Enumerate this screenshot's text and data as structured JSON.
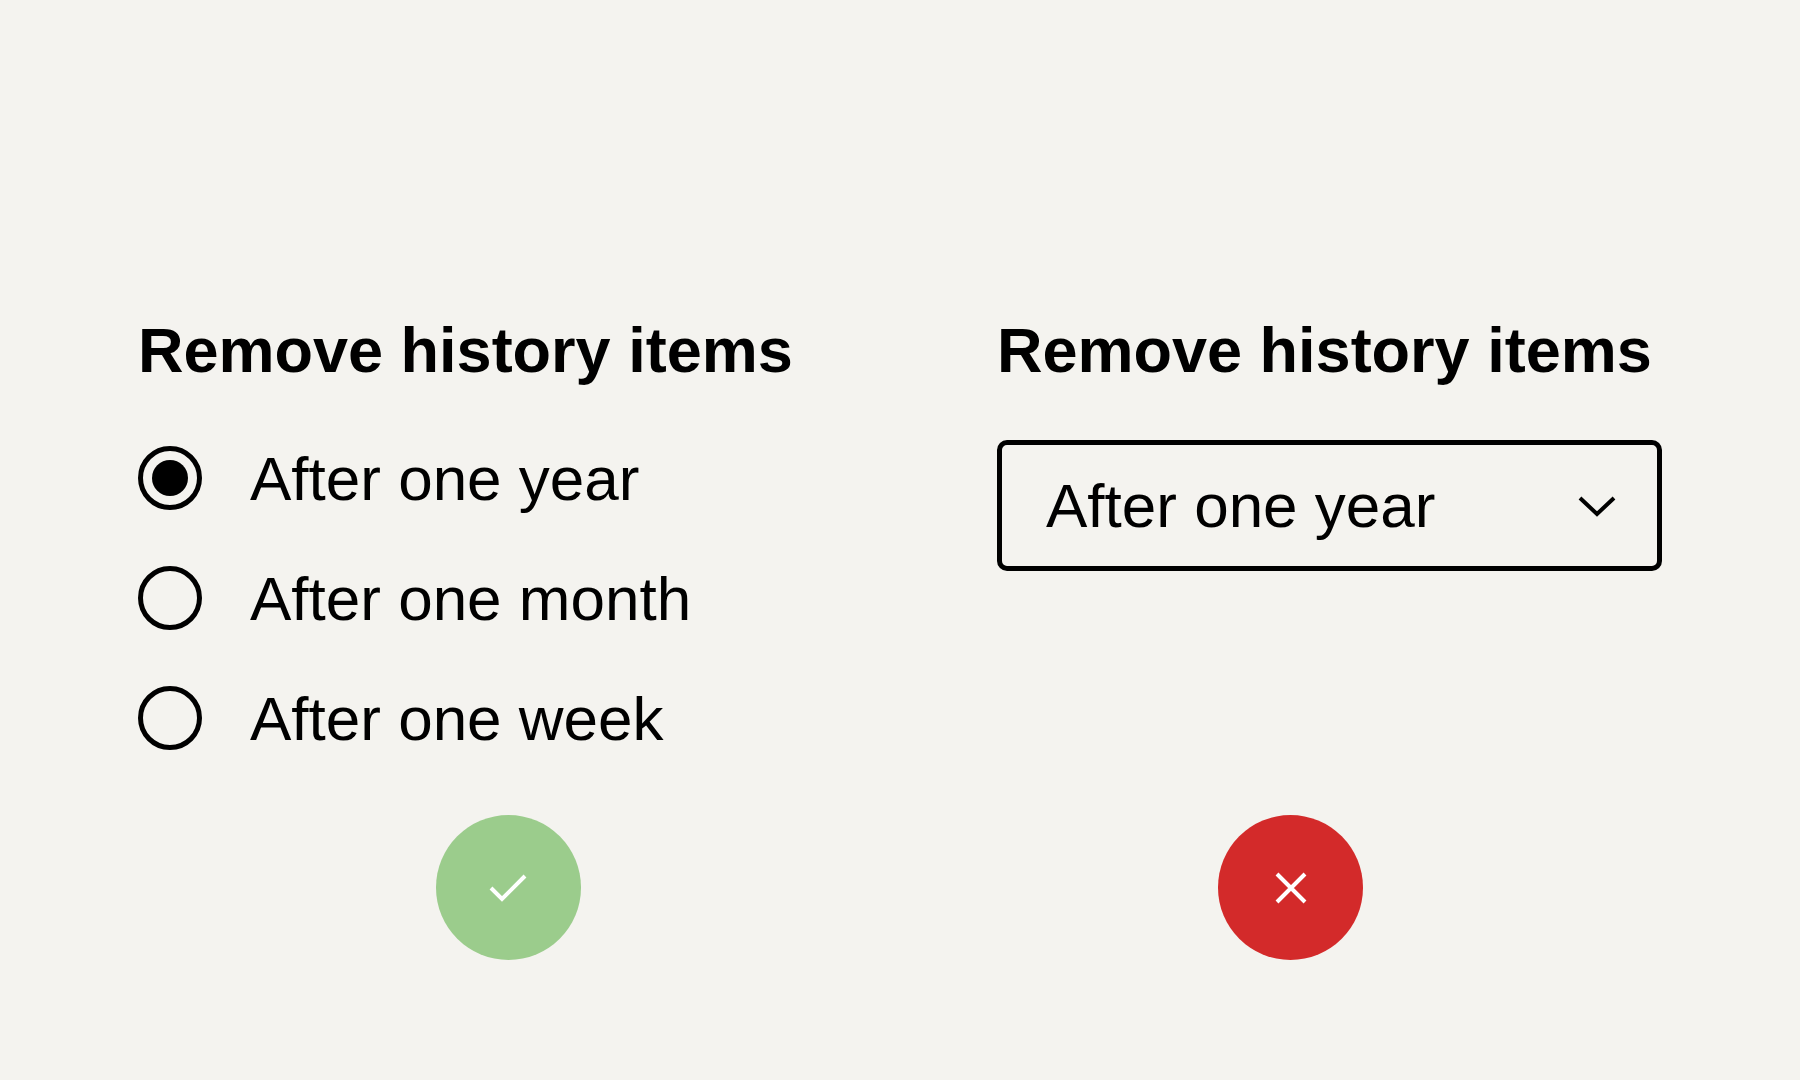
{
  "panels": [
    {
      "heading": "Remove history items",
      "kind": "radios",
      "options": [
        {
          "label": "After one year",
          "selected": true
        },
        {
          "label": "After one month",
          "selected": false
        },
        {
          "label": "After one week",
          "selected": false
        }
      ],
      "correct": true
    },
    {
      "heading": "Remove history items",
      "kind": "select",
      "value": "After one year",
      "correct": false
    }
  ]
}
